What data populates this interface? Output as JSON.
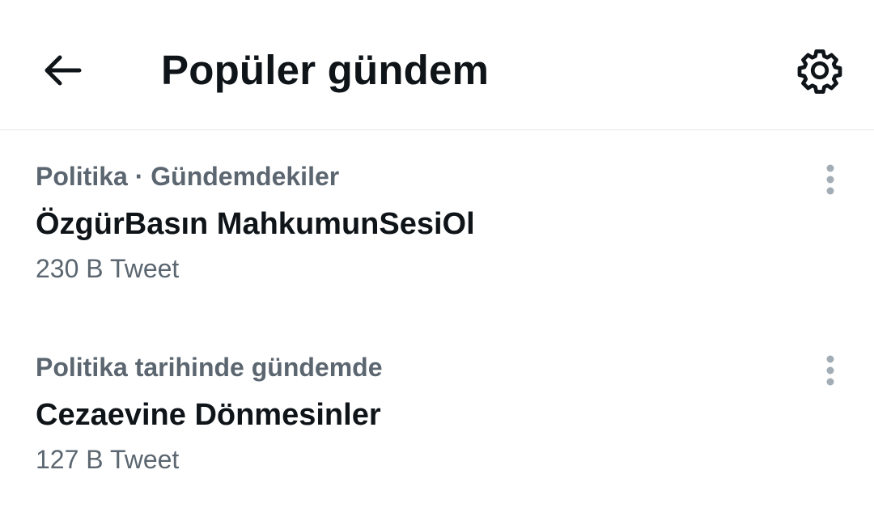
{
  "header": {
    "title": "Popüler gündem",
    "back_icon": "arrow-left-icon",
    "settings_icon": "gear-icon"
  },
  "trends": [
    {
      "context": "Politika · Gündemdekiler",
      "name": "ÖzgürBasın MahkumunSesiOl",
      "count": "230 B Tweet",
      "menu_icon": "more-vertical-icon"
    },
    {
      "context": "Politika tarihinde gündemde",
      "name": "Cezaevine Dönmesinler",
      "count": "127 B Tweet",
      "menu_icon": "more-vertical-icon"
    }
  ],
  "colors": {
    "primary_text": "#0f1419",
    "secondary_text": "#5b6670",
    "divider": "#e3e6e8",
    "menu_dots": "#a3adb5"
  }
}
